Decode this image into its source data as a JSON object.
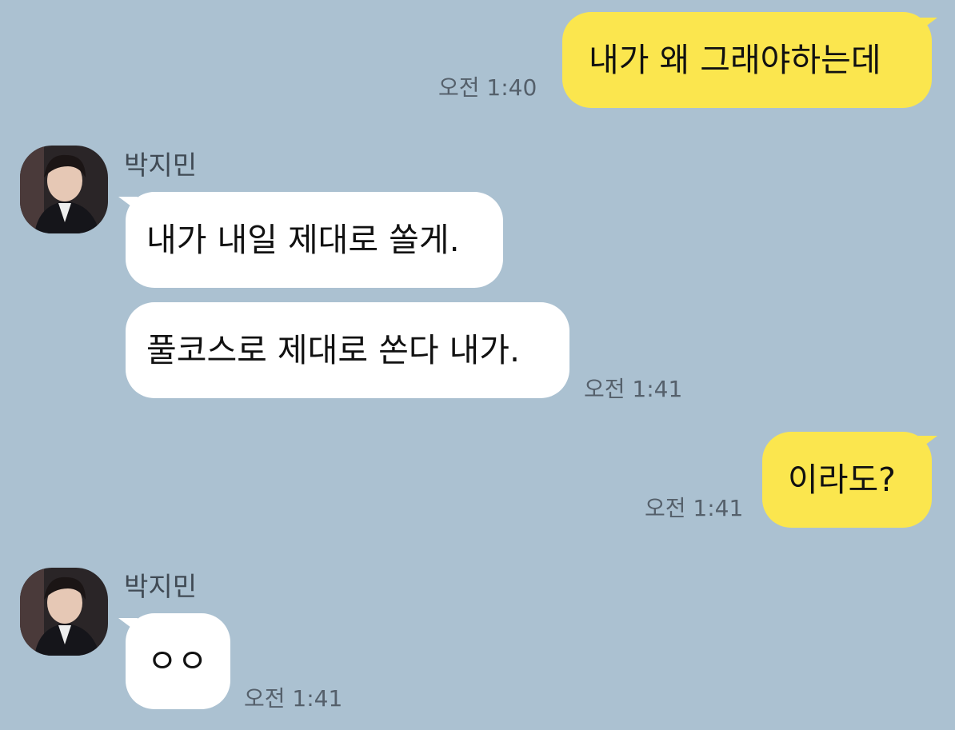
{
  "messages": [
    {
      "text": "내가 왜 그래야하는데",
      "time": "오전 1:40"
    },
    {
      "sender": "박지민",
      "text": "내가 내일 제대로 쏠게."
    },
    {
      "text": "풀코스로 제대로 쏜다 내가.",
      "time": "오전 1:41"
    },
    {
      "text": "이라도?",
      "time": "오전 1:41"
    },
    {
      "sender": "박지민",
      "text": "ㅇㅇ",
      "time": "오전 1:41"
    }
  ],
  "colors": {
    "background": "#abc1d1",
    "outgoing_bubble": "#fbe64e",
    "incoming_bubble": "#ffffff",
    "time_text": "#55606b"
  },
  "icons": {
    "avatar": "profile-photo-icon"
  }
}
